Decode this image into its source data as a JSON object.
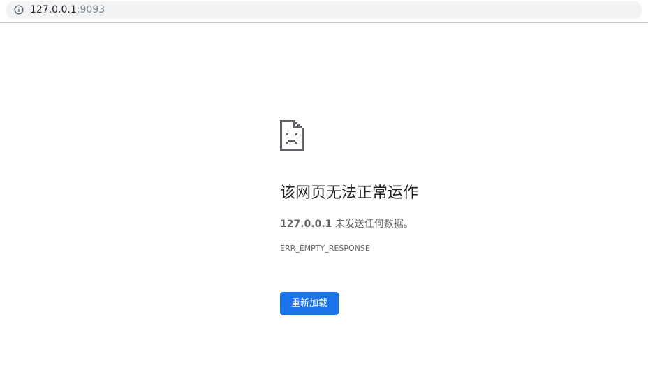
{
  "address_bar": {
    "icon": "info-icon",
    "host": "127.0.0.1",
    "port": ":9093"
  },
  "error": {
    "icon": "sad-page-icon",
    "title": "该网页无法正常运作",
    "host": "127.0.0.1",
    "description": " 未发送任何数据。",
    "code": "ERR_EMPTY_RESPONSE",
    "reload_label": "重新加载",
    "accent_color": "#1a73e8"
  }
}
